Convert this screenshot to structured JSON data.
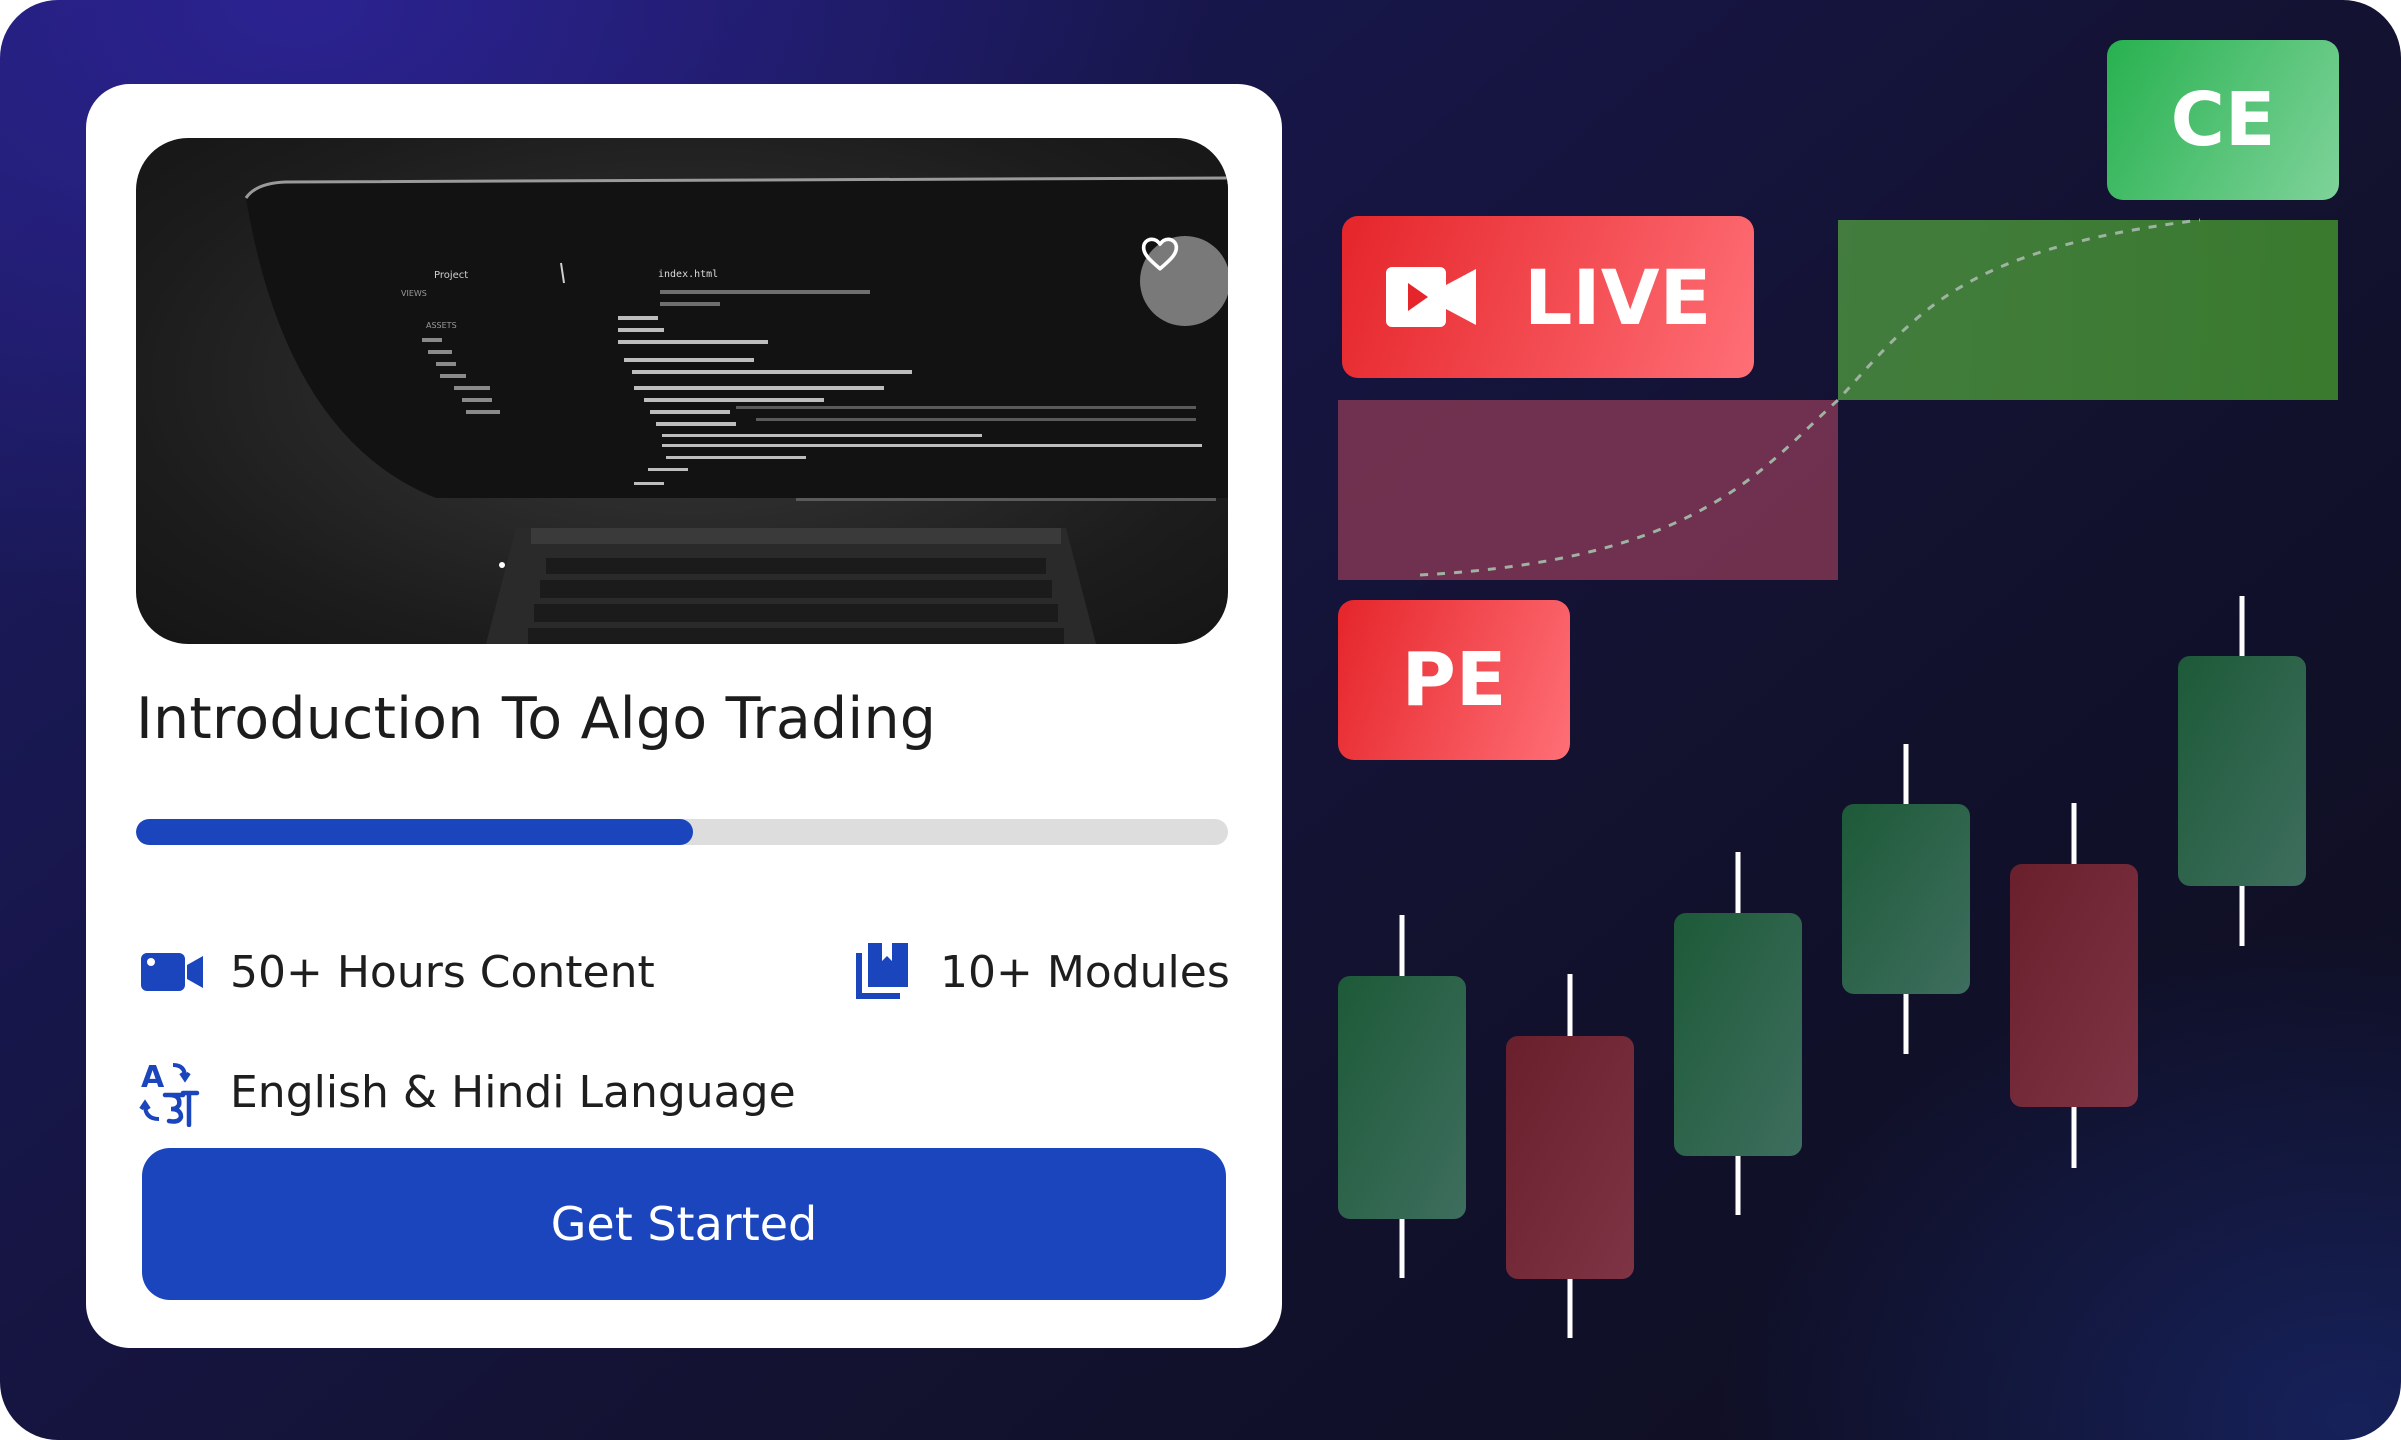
{
  "course": {
    "title": "Introduction To Algo Trading",
    "progress_percent": 51,
    "features": {
      "hours": "50+ Hours Content",
      "modules": "10+ Modules",
      "language": "English & Hindi Language"
    },
    "cta_label": "Get Started",
    "thumbnail": {
      "sidebar_header": "Project",
      "file_tab": "index.html",
      "sidebar_views": "VIEWS",
      "sidebar_assets": "ASSETS"
    }
  },
  "badges": {
    "ce": "CE",
    "live": "LIVE",
    "pe": "PE"
  },
  "colors": {
    "primary_blue": "#1a45bd",
    "live_red": "#e5252a",
    "ce_green": "#27b14f",
    "candle_green": "#1f5b3e",
    "candle_red": "#6e2636"
  },
  "icons": {
    "favorite": "heart-icon",
    "hours": "video-camera-icon",
    "modules": "book-stack-icon",
    "language": "translate-icon",
    "live": "video-camera-icon"
  }
}
